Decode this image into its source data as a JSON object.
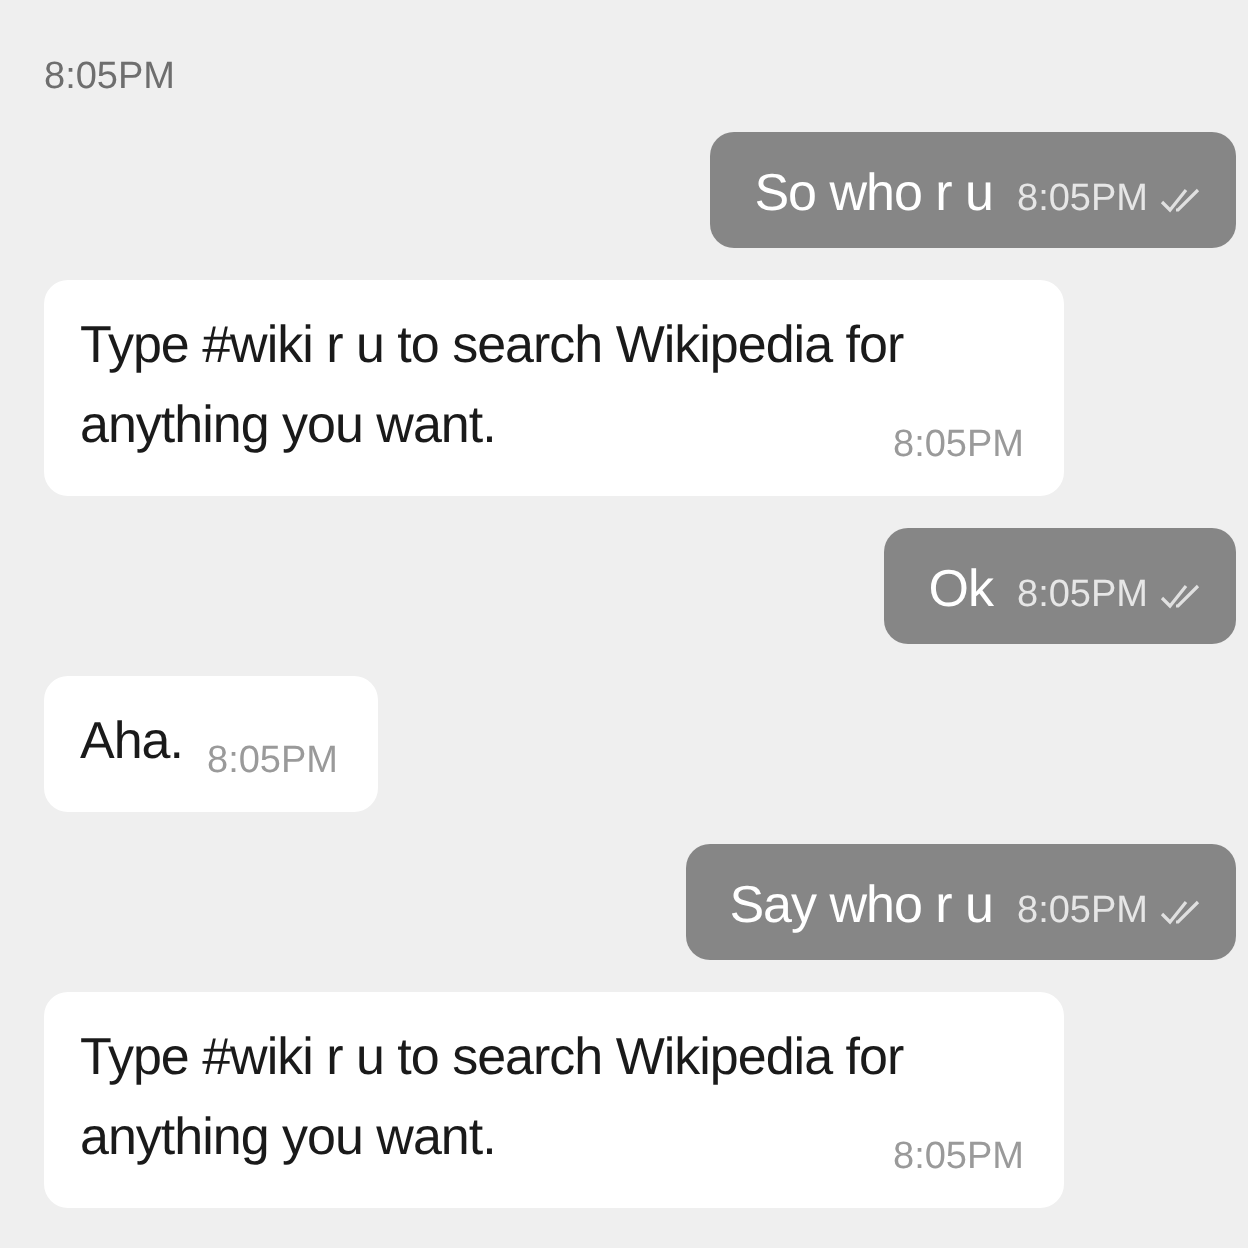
{
  "header_time": "8:05PM",
  "messages": [
    {
      "kind": "outgoing",
      "text": "So who r u",
      "time": "8:05PM",
      "read": true
    },
    {
      "kind": "incoming",
      "text": "Type #wiki r u to search Wikipedia for anything you want.",
      "time": "8:05PM"
    },
    {
      "kind": "outgoing",
      "text": "Ok",
      "time": "8:05PM",
      "read": true
    },
    {
      "kind": "incoming",
      "text": "Aha.",
      "time": "8:05PM"
    },
    {
      "kind": "outgoing",
      "text": "Say who r u",
      "time": "8:05PM",
      "read": true
    },
    {
      "kind": "incoming",
      "text": "Type #wiki r u to search Wikipedia for anything you want.",
      "time": "8:05PM"
    }
  ]
}
